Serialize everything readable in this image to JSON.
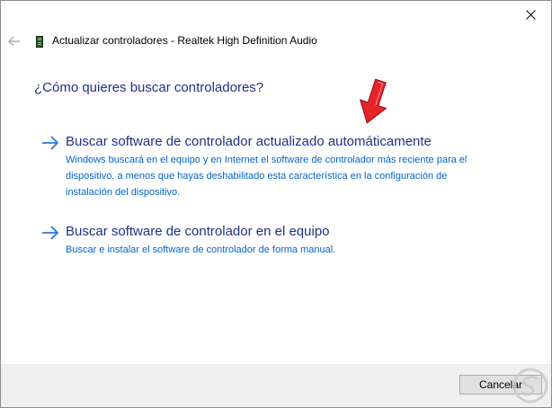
{
  "window": {
    "header_title": "Actualizar controladores - Realtek High Definition Audio"
  },
  "main": {
    "question": "¿Cómo quieres buscar controladores?",
    "options": [
      {
        "title": "Buscar software de controlador actualizado automáticamente",
        "description": "Windows buscará en el equipo y en Internet el software de controlador más reciente para el dispositivo, a menos que hayas deshabilitado esta característica en la configuración de instalación del dispositivo."
      },
      {
        "title": "Buscar software de controlador en el equipo",
        "description": "Buscar e instalar el software de controlador de forma manual."
      }
    ]
  },
  "footer": {
    "cancel_label": "Cancelar"
  },
  "icons": {
    "close": "close-icon",
    "back": "back-arrow-icon",
    "device": "audio-device-icon",
    "option_arrow": "arrow-right-icon",
    "annotation": "red-arrow-icon",
    "watermark": "solvetic-logo-icon"
  },
  "colors": {
    "link_title": "#1e3287",
    "link_desc": "#0066cc",
    "option_arrow": "#2a7ad5",
    "annotation_arrow": "#e8242b",
    "footer_bg": "#f0f0f0"
  }
}
